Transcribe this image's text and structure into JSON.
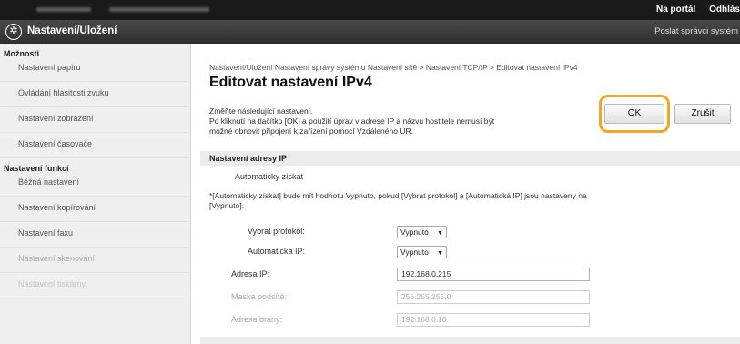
{
  "topbar": {
    "links": [
      "Na portál",
      "Odhlás"
    ]
  },
  "header": {
    "title": "Nastavení/Uložení",
    "right_link": "Poslat správci systém"
  },
  "sidebar": {
    "section1": "Možnosti",
    "items1": [
      "Nastavení papíru",
      "Ovládání hlasitosti zvuku",
      "Nastavení zobrazení",
      "Nastavení časovače"
    ],
    "section2": "Nastavení funkcí",
    "items2": [
      "Běžná nastavení",
      "Nastavení kopírování",
      "Nastavení faxu",
      "Nastavení skenování",
      "Nastavení tiskárny"
    ]
  },
  "main": {
    "breadcrumb": "Nastavení/Uložení  Nastavení správy systému  Nastavení sítě > Nastavení TCP/IP > Editovat nastavení IPv4",
    "title": "Editovat nastavení IPv4",
    "desc_line1": "Změňte následující nastavení.",
    "desc_line2": "Po kliknutí na tlačítko [OK] a použití úprav v adrese IP a názvu hostitele nemusí být",
    "desc_line3": "možné obnovit připojení k zařízení pomocí Vzdáleného UR.",
    "ok_label": "OK",
    "cancel_label": "Zrušit",
    "section_title": "Nastavení adresy IP",
    "auto_label": "Automaticky získat",
    "note_line1": "*[Automaticky získat] bude mít hodnotu Vypnuto, pokud [Vybrat protokol] a [Automatická IP] jsou nastaveny na",
    "note_line2": "[Vypnuto].",
    "protocol_label": "Vybrat protokol:",
    "protocol_value": "Vypnuto",
    "autoip_label": "Automatická IP:",
    "autoip_value": "Vypnuto",
    "ip_label": "Adresa IP:",
    "ip_value": "192.168.0.215",
    "mask_label": "Maska podsítě:",
    "mask_value": "255.255.255.0",
    "gateway_label": "Adresa brány:",
    "gateway_value": "192.168.0.10"
  },
  "icons": {
    "logo": "gear-icon",
    "dropdown": "chevron-down-icon"
  },
  "colors": {
    "highlight": "#f5a623",
    "header": "#2e2e2e",
    "topbar": "#1a1a1a"
  }
}
